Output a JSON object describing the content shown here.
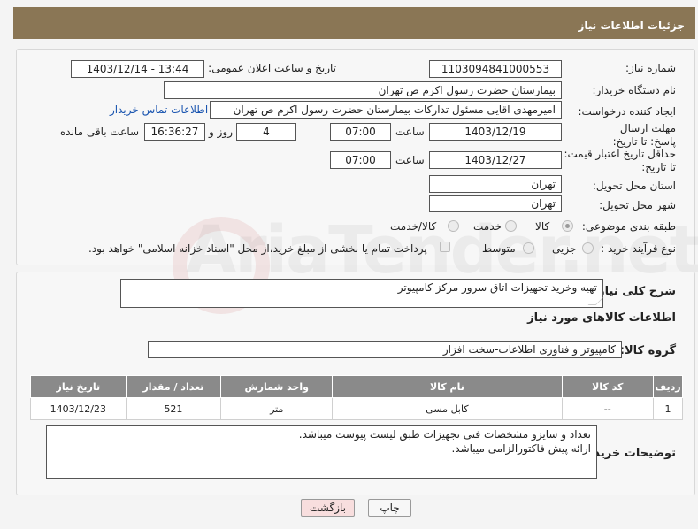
{
  "header": {
    "title": "جزئیات اطلاعات نیاز"
  },
  "form": {
    "need_number": {
      "label": "شماره نیاز:",
      "value": "1103094841000553"
    },
    "announce_datetime": {
      "label": "تاریخ و ساعت اعلان عمومی:",
      "value": "1403/12/14 - 13:44"
    },
    "buyer_org": {
      "label": "نام دستگاه خریدار:",
      "value": "بیمارستان حضرت رسول اکرم ص  تهران"
    },
    "requester": {
      "label": "ایجاد کننده درخواست:",
      "value": "امیرمهدی اقایی مسئول تدارکات  بیمارستان حضرت رسول اکرم ص  تهران"
    },
    "contact_link": "اطلاعات تماس خریدار",
    "reply_deadline": {
      "label": "مهلت ارسال پاسخ: تا تاریخ:",
      "date": "1403/12/19",
      "time_label": "ساعت",
      "time": "07:00",
      "days": "4",
      "days_label": "روز و",
      "remaining": "16:36:27",
      "remaining_label": "ساعت باقی مانده"
    },
    "price_validity": {
      "label": "حداقل تاریخ اعتبار قیمت: تا تاریخ:",
      "date": "1403/12/27",
      "time_label": "ساعت",
      "time": "07:00"
    },
    "delivery_province": {
      "label": "استان محل تحویل:",
      "value": "تهران"
    },
    "delivery_city": {
      "label": "شهر محل تحویل:",
      "value": "تهران"
    },
    "category": {
      "label": "طبقه بندی موضوعی:",
      "options": [
        "کالا",
        "خدمت",
        "کالا/خدمت"
      ],
      "selected": "کالا"
    },
    "purchase_process": {
      "label": "نوع فرآیند خرید :",
      "options": [
        "جزیی",
        "متوسط"
      ],
      "checkbox_text": "پرداخت تمام یا بخشی از مبلغ خرید،از محل \"اسناد خزانه اسلامی\" خواهد بود."
    }
  },
  "details": {
    "description_label": "شرح کلی نیاز:",
    "description": "تهیه وخرید تجهیزات اتاق سرور مرکز کامپیوتر",
    "goods_info_title": "اطلاعات کالاهای مورد نیاز",
    "goods_group_label": "گروه کالا:",
    "goods_group": "کامپیوتر و فناوری اطلاعات-سخت افزار",
    "table": {
      "headers": [
        "ردیف",
        "کد کالا",
        "نام کالا",
        "واحد شمارش",
        "تعداد / مقدار",
        "تاریخ نیاز"
      ],
      "rows": [
        [
          "1",
          "--",
          "کابل مسی",
          "متر",
          "521",
          "1403/12/23"
        ]
      ]
    },
    "buyer_notes_label": "توضیحات خریدار:",
    "buyer_notes": [
      "تعداد و سایزو مشخصات فنی تجهیزات طبق لیست پیوست میباشد.",
      "ارائه پیش فاکتورالزامی میباشد."
    ]
  },
  "buttons": {
    "print": "چاپ",
    "back": "بازگشت"
  },
  "watermark": "AriaTender.net",
  "colors": {
    "header_bg": "#8a7655",
    "table_header_bg": "#8a8a8a",
    "link": "#1a55b0",
    "back_button_bg": "#f8dede"
  }
}
